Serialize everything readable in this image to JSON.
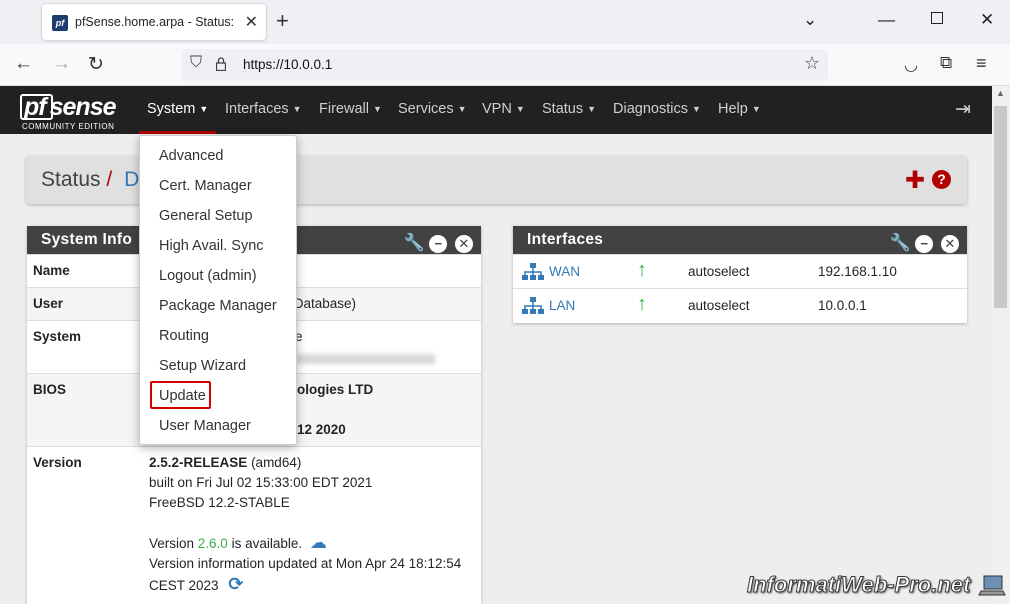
{
  "browser": {
    "tab_title": "pfSense.home.arpa - Status: Dashboard",
    "tab_favicon": "pf",
    "url": "https://10.0.0.1"
  },
  "nav": {
    "logo_main": "sense",
    "logo_prefix": "pf",
    "logo_sub": "COMMUNITY EDITION",
    "items": [
      "System",
      "Interfaces",
      "Firewall",
      "Services",
      "VPN",
      "Status",
      "Diagnostics",
      "Help"
    ]
  },
  "breadcrumb": {
    "section": "Status",
    "separator": "/",
    "page": "D"
  },
  "system_panel": {
    "title": "System Info",
    "rows": {
      "name_key": "Name",
      "user_key": "User",
      "user_value": "l Database)",
      "system_key": "System",
      "system_value": "e",
      "bios_key": "BIOS",
      "bios_value1": "ologies LTD",
      "bios_value2": "12 2020",
      "version_key": "Version",
      "version_release": "2.5.2-RELEASE",
      "version_arch": "(amd64)",
      "version_built": "built on Fri Jul 02 15:33:00 EDT 2021",
      "version_os": "FreeBSD 12.2-STABLE",
      "version_avail_pre": "Version ",
      "version_avail_num": "2.6.0",
      "version_avail_post": " is available.",
      "version_updated1": "Version information updated at Mon Apr 24 18:12:54",
      "version_updated2": "CEST 2023"
    }
  },
  "interfaces_panel": {
    "title": "Interfaces",
    "rows": [
      {
        "name": "WAN",
        "media": "autoselect",
        "ip": "192.168.1.10"
      },
      {
        "name": "LAN",
        "media": "autoselect",
        "ip": "10.0.0.1"
      }
    ]
  },
  "system_menu": {
    "items": [
      "Advanced",
      "Cert. Manager",
      "General Setup",
      "High Avail. Sync",
      "Logout (admin)",
      "Package Manager",
      "Routing",
      "Setup Wizard",
      "Update",
      "User Manager"
    ]
  },
  "watermark": "InformatiWeb-Pro.net",
  "colors": {
    "accent": "#b20000",
    "nav_bg": "#212121",
    "panel_head": "#424242",
    "link": "#337ab7",
    "green": "#3cb043"
  }
}
